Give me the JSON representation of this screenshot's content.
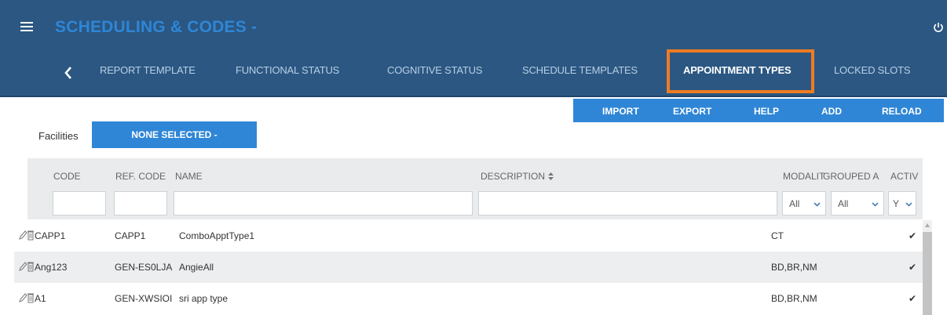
{
  "app": {
    "title": "SCHEDULING & CODES -"
  },
  "nav": {
    "tabs": [
      {
        "label": "REPORT TEMPLATE"
      },
      {
        "label": "FUNCTIONAL STATUS"
      },
      {
        "label": "COGNITIVE STATUS"
      },
      {
        "label": "SCHEDULE TEMPLATES"
      },
      {
        "label": "APPOINTMENT TYPES",
        "active": true
      },
      {
        "label": "LOCKED SLOTS"
      }
    ]
  },
  "actions": {
    "import": "IMPORT",
    "export": "EXPORT",
    "help": "HELP",
    "add": "ADD",
    "reload": "RELOAD"
  },
  "facilities": {
    "label": "Facilities",
    "value": "NONE SELECTED -"
  },
  "table": {
    "columns": {
      "code": "CODE",
      "ref_code": "REF. CODE",
      "name": "NAME",
      "description": "DESCRIPTION",
      "modality": "MODALIT",
      "grouped": "GROUPED A",
      "active": "ACTIV"
    },
    "filters": {
      "modality": "All",
      "grouped": "All",
      "active": "Y"
    },
    "rows": [
      {
        "code": "CAPP1",
        "ref_code": "CAPP1",
        "name": "ComboApptType1",
        "description": "",
        "modality": "CT",
        "active": "✔"
      },
      {
        "code": "Ang123",
        "ref_code": "GEN-ES0LJA",
        "name": "AngieAll",
        "description": "",
        "modality": "BD,BR,NM",
        "active": "✔"
      },
      {
        "code": "A1",
        "ref_code": "GEN-XWSIOI",
        "name": "sri app type",
        "description": "",
        "modality": "BD,BR,NM",
        "active": "✔"
      }
    ]
  },
  "colors": {
    "header_bg": "#2b5782",
    "accent": "#2f86d6",
    "highlight": "#f07b22"
  },
  "icons": {
    "menu": "hamburger-icon",
    "power": "power-icon",
    "back": "chevron-left-icon",
    "edit": "pencil-icon",
    "delete": "trash-icon",
    "sort": "sort-icon"
  }
}
